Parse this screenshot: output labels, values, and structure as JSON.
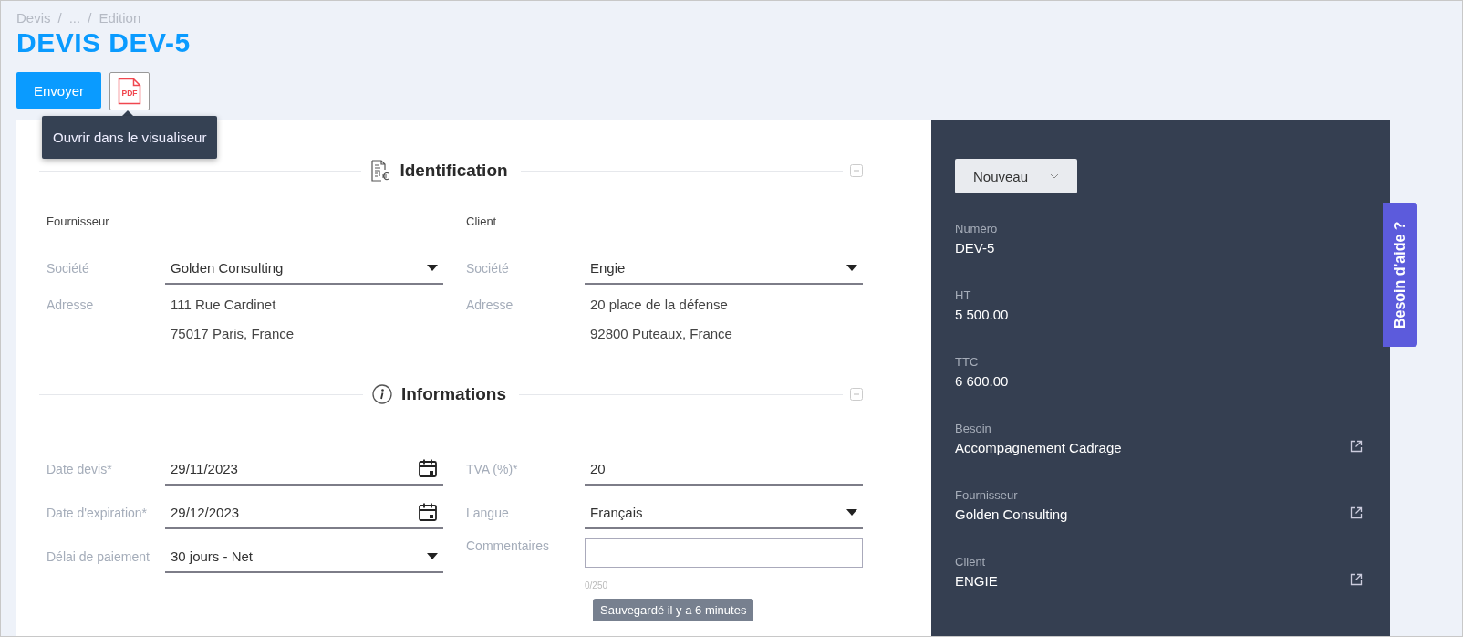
{
  "breadcrumb": {
    "separator": "/",
    "items": [
      "Devis",
      "...",
      "Edition"
    ]
  },
  "title": "DEVIS DEV-5",
  "actions": {
    "send": "Envoyer",
    "pdf_label": "PDF"
  },
  "tooltip": "Ouvrir dans le visualiseur",
  "identification": {
    "title": "Identification",
    "columns": [
      {
        "heading": "Fournisseur",
        "company_label": "Société",
        "company": "Golden Consulting",
        "address_label": "Adresse",
        "address_lines": [
          "111 Rue Cardinet",
          "75017 Paris, France"
        ]
      },
      {
        "heading": "Client",
        "company_label": "Société",
        "company": "Engie",
        "address_label": "Adresse",
        "address_lines": [
          "20 place de la défense",
          "92800 Puteaux, France"
        ]
      }
    ]
  },
  "informations": {
    "title": "Informations",
    "columns": [
      [
        {
          "kind": "date",
          "label": "Date devis*",
          "value": "29/11/2023"
        },
        {
          "kind": "date",
          "label": "Date d'expiration*",
          "value": "29/12/2023"
        },
        {
          "kind": "select",
          "label": "Délai de paiement",
          "value": "30 jours - Net"
        }
      ],
      [
        {
          "kind": "text",
          "label": "TVA (%)*",
          "value": "20"
        },
        {
          "kind": "select",
          "label": "Langue",
          "value": "Français"
        },
        {
          "kind": "textarea",
          "label": "Commentaires",
          "counter": "0/250"
        }
      ]
    ]
  },
  "toast": "Sauvegardé il y a 6 minutes",
  "sidebar": {
    "status": "Nouveau",
    "fields": [
      {
        "label": "Numéro",
        "value": "DEV-5",
        "link": false
      },
      {
        "label": "HT",
        "value": "5 500.00",
        "link": false
      },
      {
        "label": "TTC",
        "value": "6 600.00",
        "link": false
      },
      {
        "label": "Besoin",
        "value": "Accompagnement Cadrage",
        "link": true
      },
      {
        "label": "Fournisseur",
        "value": "Golden Consulting",
        "link": true
      },
      {
        "label": "Client",
        "value": "ENGIE",
        "link": true
      }
    ]
  },
  "help_tab": "Besoin d'aide ?"
}
